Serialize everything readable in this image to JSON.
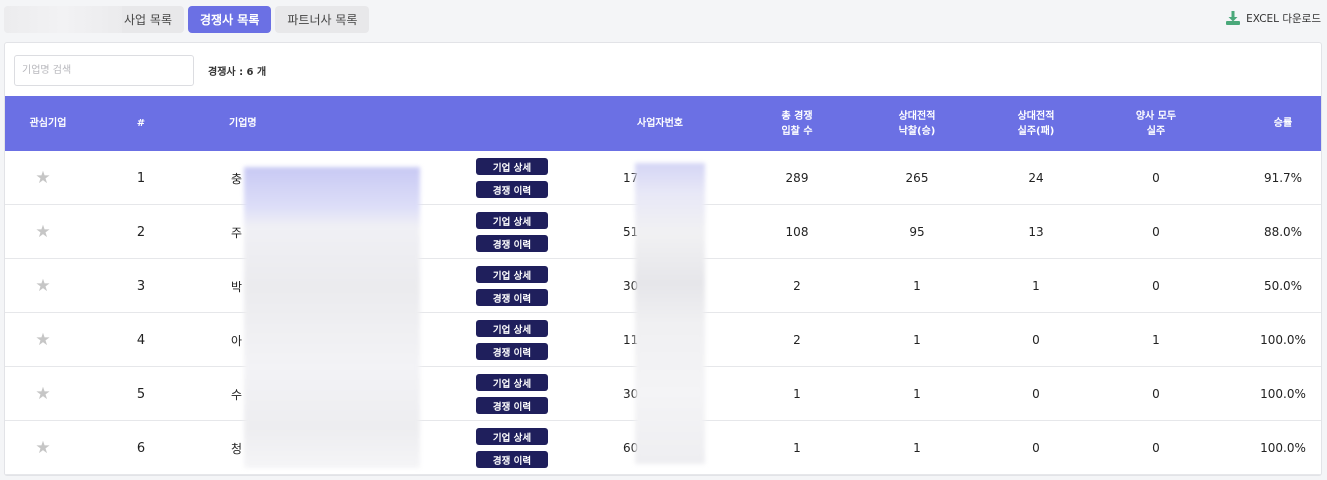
{
  "tabs": [
    {
      "label": "사업 목록",
      "active": false
    },
    {
      "label": "경쟁사 목록",
      "active": true
    },
    {
      "label": "파트너사 목록",
      "active": false
    }
  ],
  "excel_label": "EXCEL 다운로드",
  "search": {
    "placeholder": "기업명 검색",
    "value": ""
  },
  "count_label": "경쟁사 : 6 개",
  "columns": [
    "관심기업",
    "#",
    "기업명",
    "사업자번호",
    "총 경쟁\n입찰 수",
    "상대전적\n낙찰(승)",
    "상대전적\n실주(패)",
    "양사 모두\n실주",
    "승률"
  ],
  "buttons": {
    "detail": "기업 상세",
    "history": "경쟁 이력"
  },
  "icons": {
    "star": "star-icon",
    "download": "download-icon"
  },
  "colors": {
    "accent": "#6b70e4",
    "button": "#1f1f5c",
    "excel_icon": "#4aa87a"
  },
  "rows": [
    {
      "no": "1",
      "name": "충",
      "biz_no": "17",
      "total": "289",
      "wins": "265",
      "losses": "24",
      "both_lost": "0",
      "rate": "91.7%"
    },
    {
      "no": "2",
      "name": "주",
      "biz_no": "51",
      "total": "108",
      "wins": "95",
      "losses": "13",
      "both_lost": "0",
      "rate": "88.0%"
    },
    {
      "no": "3",
      "name": "박",
      "biz_no": "30",
      "total": "2",
      "wins": "1",
      "losses": "1",
      "both_lost": "0",
      "rate": "50.0%"
    },
    {
      "no": "4",
      "name": "아",
      "biz_no": "11",
      "total": "2",
      "wins": "1",
      "losses": "0",
      "both_lost": "1",
      "rate": "100.0%"
    },
    {
      "no": "5",
      "name": "수",
      "biz_no": "30",
      "total": "1",
      "wins": "1",
      "losses": "0",
      "both_lost": "0",
      "rate": "100.0%"
    },
    {
      "no": "6",
      "name": "청",
      "biz_no": "60",
      "total": "1",
      "wins": "1",
      "losses": "0",
      "both_lost": "0",
      "rate": "100.0%"
    }
  ]
}
